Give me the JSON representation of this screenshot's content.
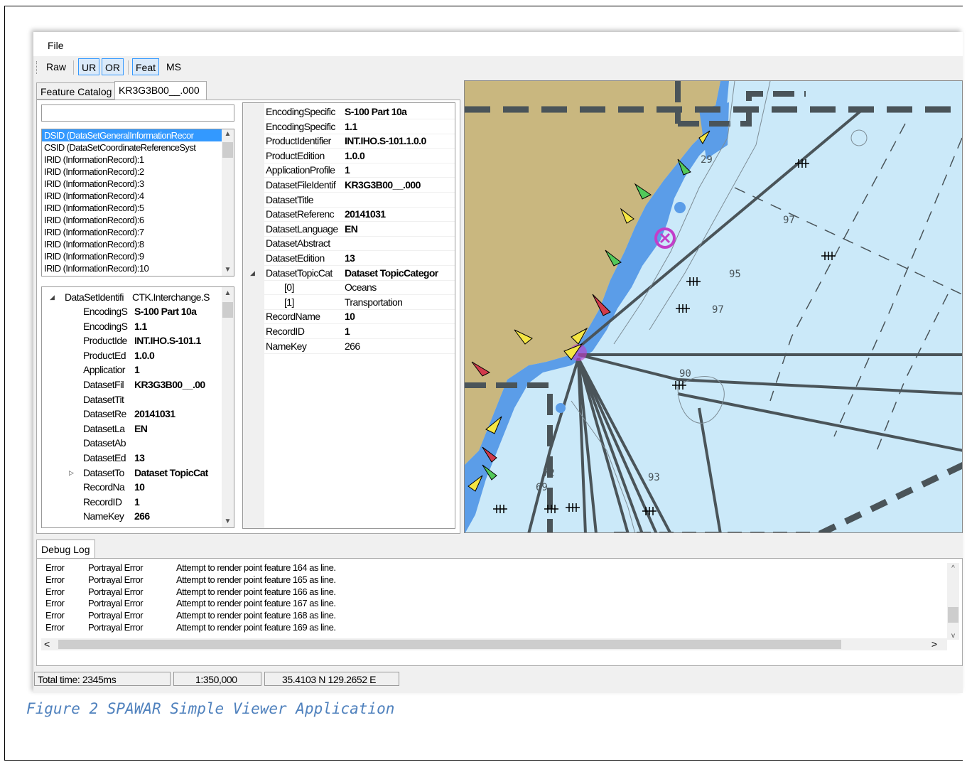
{
  "menu": {
    "file": "File"
  },
  "toolbar": {
    "raw": "Raw",
    "ur": "UR",
    "or": "OR",
    "feat": "Feat",
    "ms": "MS"
  },
  "left_tabs": {
    "feature_catalog": "Feature Catalog",
    "dataset": "KR3G3B00__.000"
  },
  "search": {
    "value": ""
  },
  "record_list": [
    "DSID (DataSetGeneralInformationRecor",
    "CSID (DataSetCoordinateReferenceSyst",
    "IRID (InformationRecord):1",
    "IRID (InformationRecord):2",
    "IRID (InformationRecord):3",
    "IRID (InformationRecord):4",
    "IRID (InformationRecord):5",
    "IRID (InformationRecord):6",
    "IRID (InformationRecord):7",
    "IRID (InformationRecord):8",
    "IRID (InformationRecord):9",
    "IRID (InformationRecord):10"
  ],
  "tree": {
    "root_key": "DataSetIdentifi",
    "root_value": "CTK.Interchange.S",
    "rows": [
      {
        "k": "EncodingS",
        "v": "S-100 Part 10a"
      },
      {
        "k": "EncodingS",
        "v": "1.1"
      },
      {
        "k": "ProductIde",
        "v": "INT.IHO.S-101.1"
      },
      {
        "k": "ProductEd",
        "v": "1.0.0"
      },
      {
        "k": "Applicatior",
        "v": "1"
      },
      {
        "k": "DatasetFil",
        "v": "KR3G3B00__.00"
      },
      {
        "k": "DatasetTit",
        "v": ""
      },
      {
        "k": "DatasetRe",
        "v": "20141031"
      },
      {
        "k": "DatasetLa",
        "v": "EN"
      },
      {
        "k": "DatasetAb",
        "v": ""
      },
      {
        "k": "DatasetEd",
        "v": "13"
      },
      {
        "k": "DatasetTo",
        "v": "Dataset TopicCat"
      },
      {
        "k": "RecordNa",
        "v": "10"
      },
      {
        "k": "RecordID",
        "v": "1"
      },
      {
        "k": "NameKey",
        "v": "266"
      }
    ]
  },
  "properties": [
    {
      "k": "EncodingSpecific",
      "v": "S-100 Part 10a",
      "bold": true
    },
    {
      "k": "EncodingSpecific",
      "v": "1.1",
      "bold": true
    },
    {
      "k": "ProductIdentifier",
      "v": "INT.IHO.S-101.1.0.0",
      "bold": true
    },
    {
      "k": "ProductEdition",
      "v": "1.0.0",
      "bold": true
    },
    {
      "k": "ApplicationProfile",
      "v": "1",
      "bold": true
    },
    {
      "k": "DatasetFileIdentif",
      "v": "KR3G3B00__.000",
      "bold": true
    },
    {
      "k": "DatasetTitle",
      "v": "",
      "bold": false
    },
    {
      "k": "DatasetReferenc",
      "v": "20141031",
      "bold": true
    },
    {
      "k": "DatasetLanguage",
      "v": "EN",
      "bold": true
    },
    {
      "k": "DatasetAbstract",
      "v": "",
      "bold": false
    },
    {
      "k": "DatasetEdition",
      "v": "13",
      "bold": true
    },
    {
      "k": "DatasetTopicCat",
      "v": "Dataset TopicCategor",
      "bold": true
    },
    {
      "k": "[0]",
      "v": "Oceans",
      "bold": false
    },
    {
      "k": "[1]",
      "v": "Transportation",
      "bold": false
    },
    {
      "k": "RecordName",
      "v": "10",
      "bold": true
    },
    {
      "k": "RecordID",
      "v": "1",
      "bold": true
    },
    {
      "k": "NameKey",
      "v": "266",
      "bold": false
    }
  ],
  "map": {
    "depths": [
      "97",
      "95",
      "97",
      "90",
      "72",
      "69",
      "93",
      "29"
    ],
    "colors": {
      "land": "#c9b77f",
      "shallow": "#5b9de8",
      "sea": "#cbe9f9",
      "route": "#4a5459",
      "danger": "#c23ec9"
    }
  },
  "debug": {
    "tab": "Debug Log",
    "entries": [
      {
        "level": "Error",
        "source": "Portrayal Error",
        "message": "Attempt to render point feature 164 as line."
      },
      {
        "level": "Error",
        "source": "Portrayal Error",
        "message": "Attempt to render point feature 165 as line."
      },
      {
        "level": "Error",
        "source": "Portrayal Error",
        "message": "Attempt to render point feature 166 as line."
      },
      {
        "level": "Error",
        "source": "Portrayal Error",
        "message": "Attempt to render point feature 167 as line."
      },
      {
        "level": "Error",
        "source": "Portrayal Error",
        "message": "Attempt to render point feature 168 as line."
      },
      {
        "level": "Error",
        "source": "Portrayal Error",
        "message": "Attempt to render point feature 169 as line."
      }
    ]
  },
  "status": {
    "time": "Total time: 2345ms",
    "scale": "1:350,000",
    "position": "35.4103 N 129.2652 E"
  },
  "caption": "Figure 2 SPAWAR Simple Viewer Application"
}
